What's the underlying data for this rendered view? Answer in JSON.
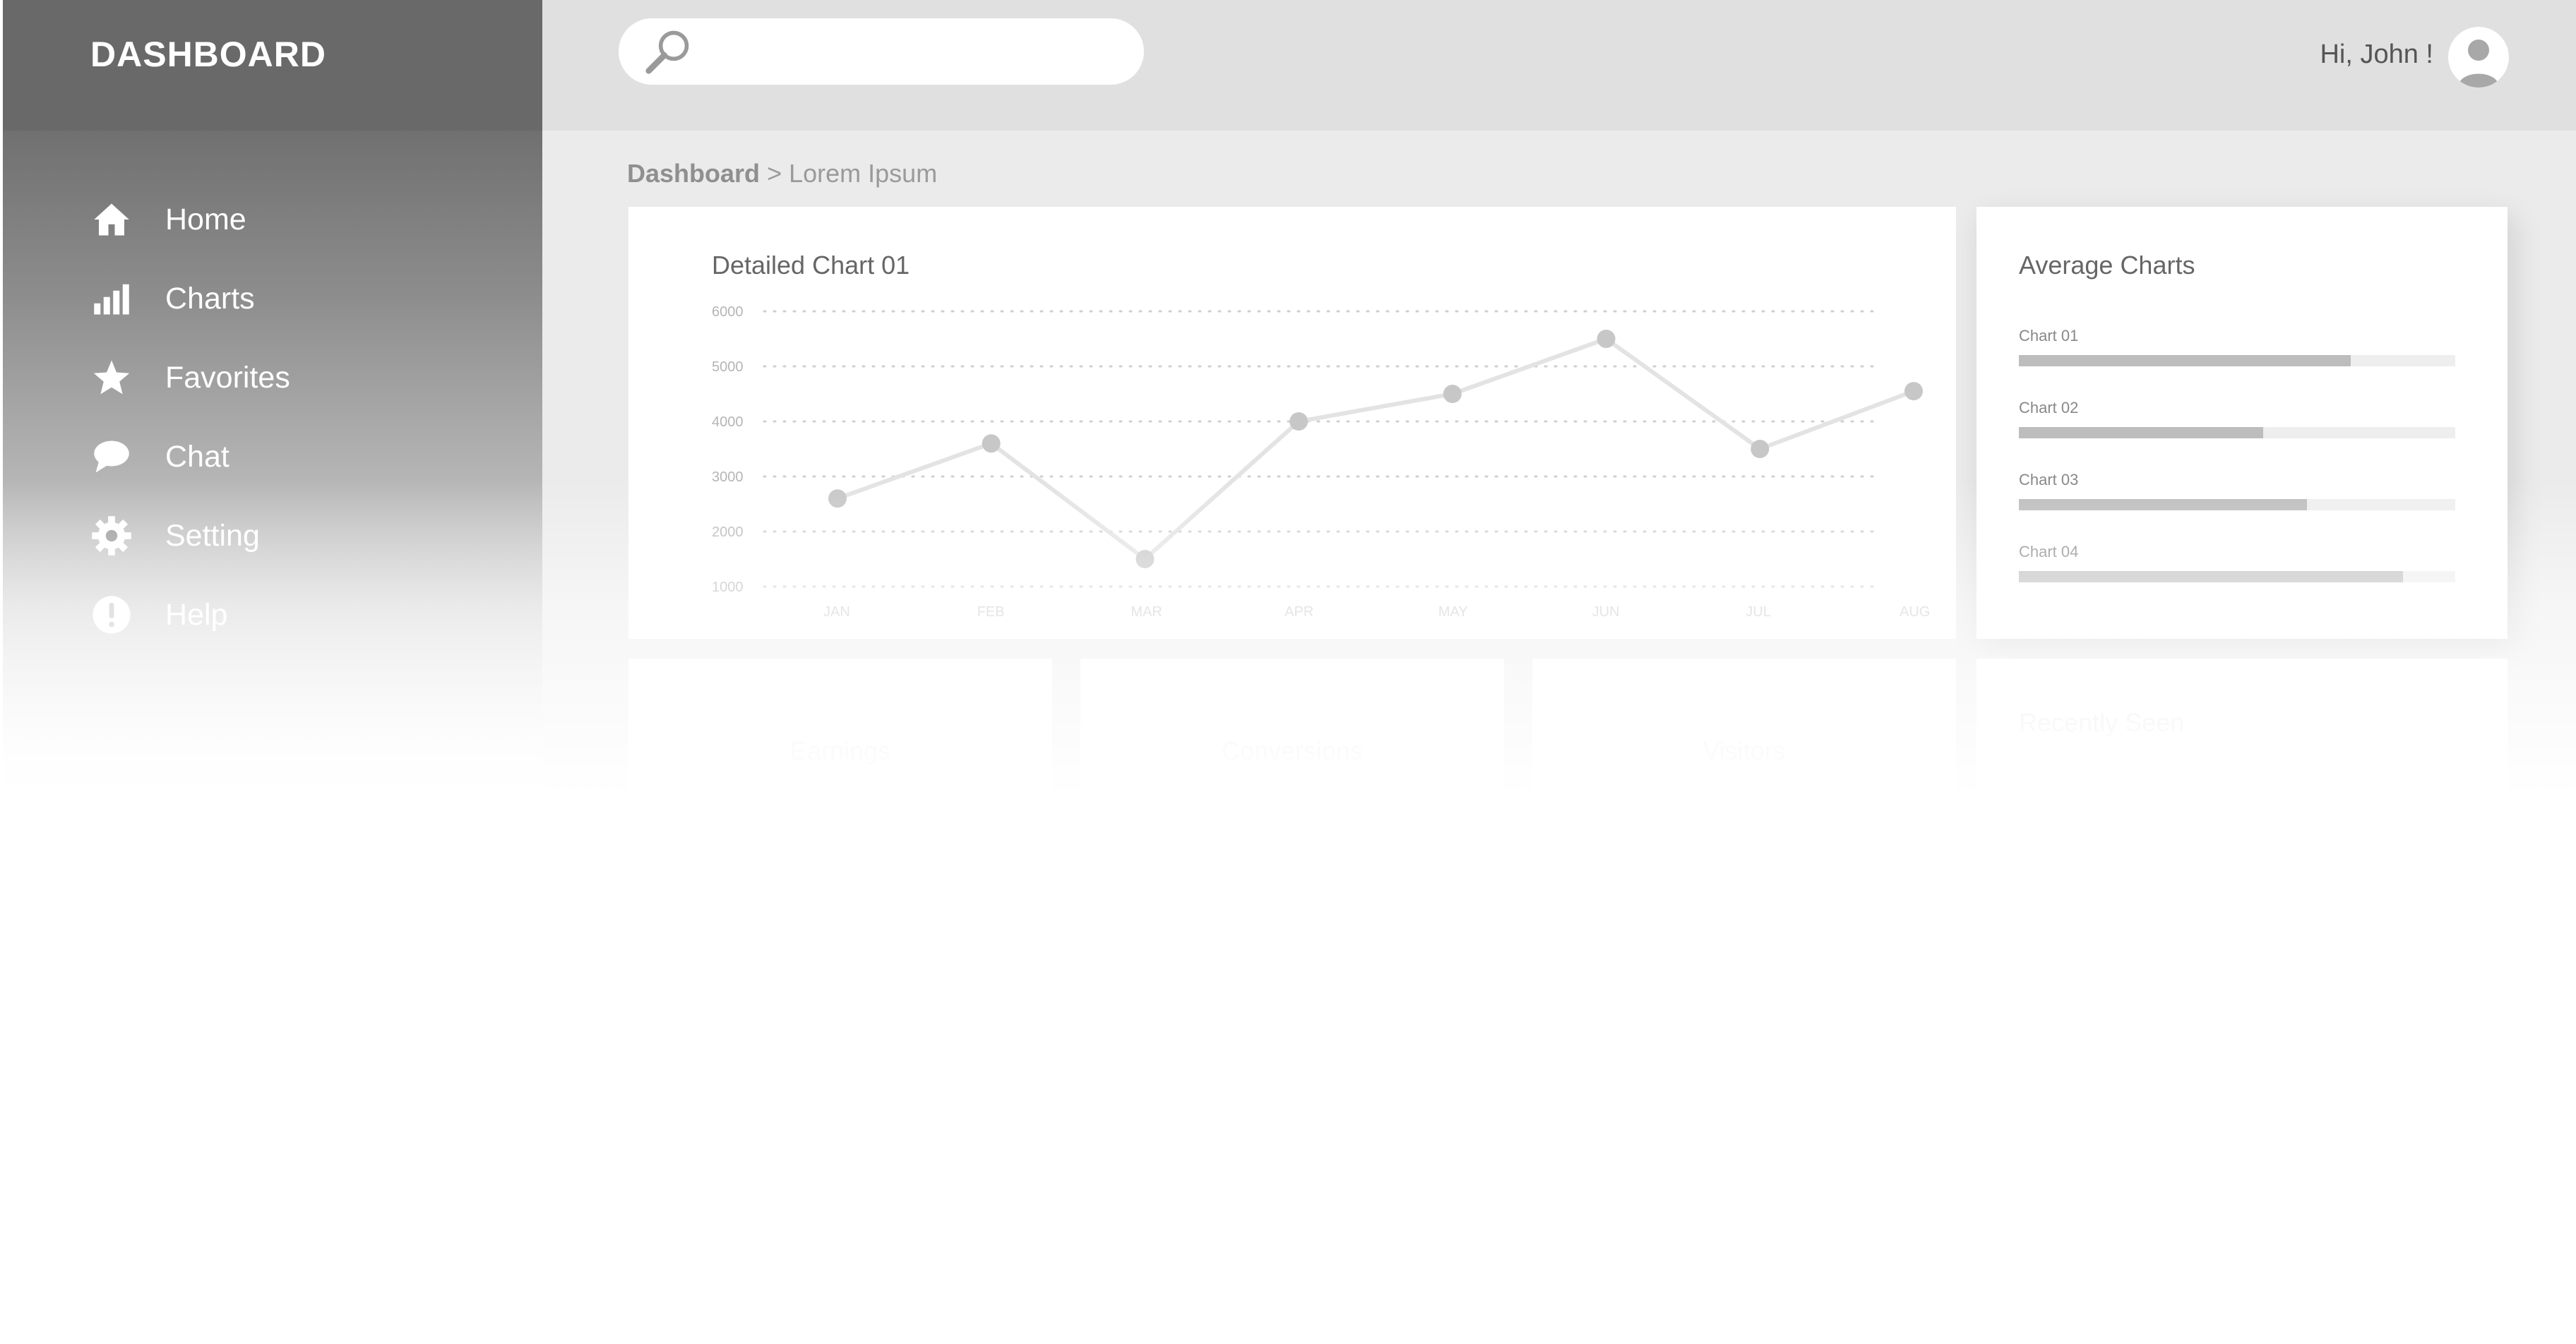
{
  "sidebar": {
    "brand": "DASHBOARD",
    "items": [
      {
        "label": "Home",
        "icon": "home-icon"
      },
      {
        "label": "Charts",
        "icon": "bar-chart-icon"
      },
      {
        "label": "Favorites",
        "icon": "star-icon"
      },
      {
        "label": "Chat",
        "icon": "chat-bubble-icon"
      },
      {
        "label": "Setting",
        "icon": "gear-icon"
      },
      {
        "label": "Help",
        "icon": "help-icon"
      }
    ]
  },
  "topbar": {
    "search_placeholder": "",
    "greeting": "Hi, John !"
  },
  "breadcrumb": {
    "root": "Dashboard",
    "separator": ">",
    "current": "Lorem Ipsum"
  },
  "detailed_chart": {
    "title": "Detailed Chart 01"
  },
  "average_charts": {
    "title": "Average Charts",
    "items": [
      {
        "label": "Chart 01",
        "fraction": 0.76
      },
      {
        "label": "Chart 02",
        "fraction": 0.56
      },
      {
        "label": "Chart 03",
        "fraction": 0.66
      },
      {
        "label": "Chart 04",
        "fraction": 0.88
      }
    ]
  },
  "bottom_cards": [
    {
      "label": "Earnings"
    },
    {
      "label": "Conversions"
    },
    {
      "label": "Visitors"
    }
  ],
  "recent_card": {
    "title": "Recently Seen"
  },
  "colors": {
    "sidebar": "#6b6b6b",
    "topbar": "#e0e0e0",
    "main_bg": "#ebebeb",
    "line": "#e3e3e3",
    "point": "#c7c7c7"
  },
  "chart_data": {
    "type": "line",
    "title": "Detailed Chart 01",
    "categories": [
      "JAN",
      "FEB",
      "MAR",
      "APR",
      "MAY",
      "JUN",
      "JUL",
      "AUG"
    ],
    "values": [
      2600,
      3600,
      1500,
      4000,
      4500,
      5500,
      3500,
      4550
    ],
    "yticks": [
      6000,
      5000,
      4000,
      3000,
      2000,
      1000
    ],
    "ylim": [
      1000,
      6000
    ],
    "grid": true,
    "grid_style": "dotted"
  }
}
